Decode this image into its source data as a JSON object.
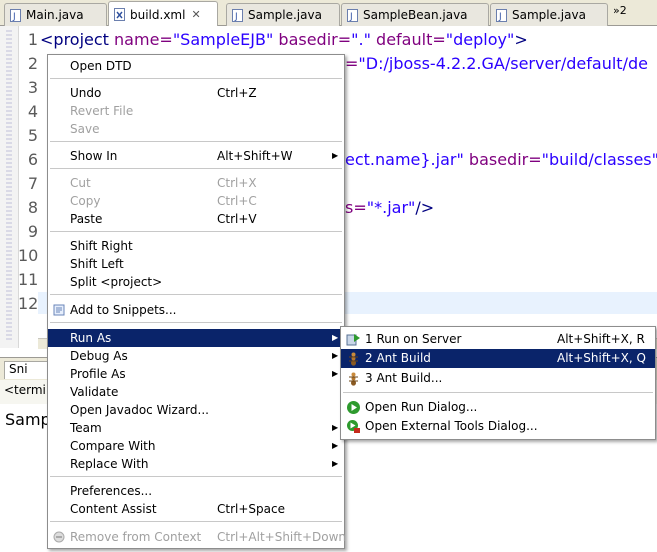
{
  "tabs": [
    {
      "label": "Main.java",
      "icon": "java-file-icon"
    },
    {
      "label": "build.xml",
      "icon": "xml-file-icon",
      "active": true
    },
    {
      "label": "Sample.java",
      "icon": "java-file-icon"
    },
    {
      "label": "SampleBean.java",
      "icon": "java-file-icon"
    },
    {
      "label": "Sample.java",
      "icon": "java-file-icon"
    }
  ],
  "tab_overflow": "»2",
  "tab_close": "✕",
  "editor": {
    "line_numbers": [
      "1",
      "2",
      "3",
      "4",
      "5",
      "6",
      "7",
      "8",
      "9",
      "10",
      "11",
      "12"
    ],
    "line1": {
      "tag": "<project ",
      "a1": "name=",
      "v1": "\"SampleEJB\"",
      "a2": " basedir=",
      "v2": "\".\"",
      "a3": " default=",
      "v3": "\"deploy\"",
      "end": ">"
    },
    "line2": {
      "a": "=",
      "v": "\"D:/jboss-4.2.2.GA/server/default/de"
    },
    "line6": {
      "v": "ect.name}.jar\"",
      "a": " basedir=",
      "v2": "\"build/classes\"/"
    },
    "line8": {
      "a": "s=",
      "v": "\"*.jar\"",
      "end": "/>"
    }
  },
  "lower_panel": {
    "tab_label": "Sni",
    "status_text": "<termi",
    "console_text": "Samp"
  },
  "context_menu": {
    "items": [
      {
        "label": "Open DTD",
        "mn": "",
        "shortcut": ""
      },
      {
        "label": "Undo",
        "mn": "U",
        "shortcut": "Ctrl+Z"
      },
      {
        "label": "Revert File",
        "mn": "v",
        "shortcut": "",
        "disabled": true
      },
      {
        "label": "Save",
        "mn": "S",
        "shortcut": "",
        "disabled": true
      },
      {
        "label": "Show In",
        "mn": "w",
        "shortcut": "Alt+Shift+W",
        "submenu": true
      },
      {
        "label": "Cut",
        "mn": "t",
        "shortcut": "Ctrl+X",
        "disabled": true
      },
      {
        "label": "Copy",
        "mn": "C",
        "shortcut": "Ctrl+C",
        "disabled": true
      },
      {
        "label": "Paste",
        "mn": "P",
        "shortcut": "Ctrl+V"
      },
      {
        "label": "Shift Right",
        "mn": "S",
        "shortcut": ""
      },
      {
        "label": "Shift Left",
        "mn": "h",
        "shortcut": ""
      },
      {
        "label": "Split <project>",
        "mn": "",
        "shortcut": ""
      },
      {
        "label": "Add to Snippets...",
        "mn": "",
        "shortcut": "",
        "icon": "snippet-icon"
      },
      {
        "label": "Run As",
        "mn": "R",
        "shortcut": "",
        "submenu": true,
        "selected": true
      },
      {
        "label": "Debug As",
        "mn": "D",
        "shortcut": "",
        "submenu": true
      },
      {
        "label": "Profile As",
        "mn": "P",
        "shortcut": "",
        "submenu": true
      },
      {
        "label": "Validate",
        "mn": "",
        "shortcut": ""
      },
      {
        "label": "Open Javadoc Wizard...",
        "mn": "",
        "shortcut": ""
      },
      {
        "label": "Team",
        "mn": "",
        "shortcut": "",
        "submenu": true
      },
      {
        "label": "Compare With",
        "mn": "",
        "shortcut": "",
        "submenu": true
      },
      {
        "label": "Replace With",
        "mn": "",
        "shortcut": "",
        "submenu": true
      },
      {
        "label": "Preferences...",
        "mn": "",
        "shortcut": ""
      },
      {
        "label": "Content Assist",
        "mn": "",
        "shortcut": "Ctrl+Space"
      },
      {
        "label": "Remove from Context",
        "mn": "",
        "shortcut": "Ctrl+Alt+Shift+Down",
        "disabled": true,
        "icon": "remove-context-icon"
      }
    ]
  },
  "run_as_submenu": {
    "items": [
      {
        "label": "1 Run on Server",
        "shortcut": "Alt+Shift+X, R",
        "icon": "run-on-server-icon"
      },
      {
        "label": "2 Ant Build",
        "shortcut": "Alt+Shift+X, Q",
        "icon": "ant-icon",
        "selected": true
      },
      {
        "label": "3 Ant Build...",
        "shortcut": "",
        "icon": "ant-icon"
      },
      {
        "label": "Open Run Dialog...",
        "shortcut": "",
        "icon": "run-icon"
      },
      {
        "label": "Open External Tools Dialog...",
        "shortcut": "",
        "icon": "external-tools-icon"
      }
    ]
  },
  "colors": {
    "selection": "#0a246a",
    "tag": "#000080",
    "attr": "#7f007f",
    "value": "#2a00ff"
  }
}
